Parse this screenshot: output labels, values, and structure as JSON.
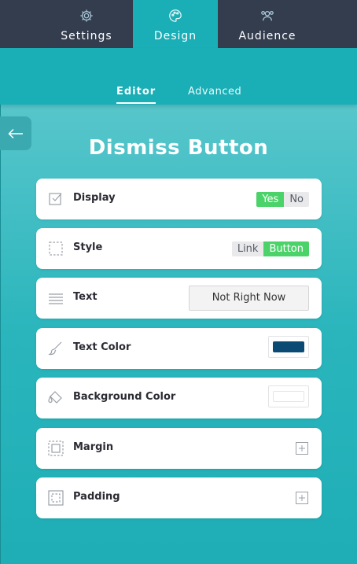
{
  "nav": {
    "tabs": [
      {
        "label": "Settings",
        "icon": "gear-icon"
      },
      {
        "label": "Design",
        "icon": "palette-icon"
      },
      {
        "label": "Audience",
        "icon": "users-icon"
      }
    ],
    "active_tab": "Design"
  },
  "subnav": {
    "tabs": [
      {
        "label": "Editor"
      },
      {
        "label": "Advanced"
      }
    ],
    "active_tab": "Editor"
  },
  "page": {
    "title": "Dismiss Button"
  },
  "settings": {
    "display": {
      "label": "Display",
      "yes": "Yes",
      "no": "No",
      "selected": "Yes"
    },
    "style": {
      "label": "Style",
      "link": "Link",
      "button": "Button",
      "selected": "Button"
    },
    "text": {
      "label": "Text",
      "value": "Not Right Now"
    },
    "text_color": {
      "label": "Text Color",
      "color": "#0b4a73"
    },
    "background_color": {
      "label": "Background Color",
      "color": "#ffffff"
    },
    "margin": {
      "label": "Margin"
    },
    "padding": {
      "label": "Padding"
    }
  },
  "colors": {
    "nav_bg": "#333d4e",
    "accent": "#1aaeb6",
    "toggle_on": "#4bd36a"
  }
}
